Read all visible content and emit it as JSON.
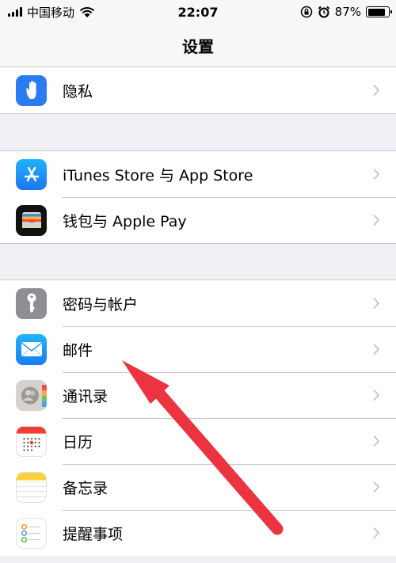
{
  "status_bar": {
    "carrier": "中国移动",
    "time": "22:07",
    "battery_percent": "87%",
    "battery_level": 0.87,
    "icons": [
      "signal-icon",
      "wifi-icon",
      "rotation-lock-icon",
      "alarm-icon",
      "battery-icon"
    ]
  },
  "nav": {
    "title": "设置"
  },
  "groups": [
    {
      "rows": [
        {
          "label": "隐私",
          "icon": "hand-icon",
          "icon_color": "#2b7bf3"
        }
      ]
    },
    {
      "rows": [
        {
          "label": "iTunes Store 与 App Store",
          "icon": "app-store-icon",
          "icon_color": "#1e8ef5"
        },
        {
          "label": "钱包与 Apple Pay",
          "icon": "wallet-icon",
          "icon_color": "#111111"
        }
      ]
    },
    {
      "rows": [
        {
          "label": "密码与帐户",
          "icon": "key-icon",
          "icon_color": "#8e8e93"
        },
        {
          "label": "邮件",
          "icon": "mail-icon",
          "icon_color": "#2d8ef6"
        },
        {
          "label": "通讯录",
          "icon": "contacts-icon",
          "icon_color": "#d6d3ce"
        },
        {
          "label": "日历",
          "icon": "calendar-icon",
          "icon_color": "#ffffff"
        },
        {
          "label": "备忘录",
          "icon": "notes-icon",
          "icon_color": "#ffffff"
        },
        {
          "label": "提醒事项",
          "icon": "reminders-icon",
          "icon_color": "#ffffff"
        }
      ]
    }
  ],
  "annotation": {
    "arrow_color": "#ec3340",
    "points_to": "邮件"
  }
}
